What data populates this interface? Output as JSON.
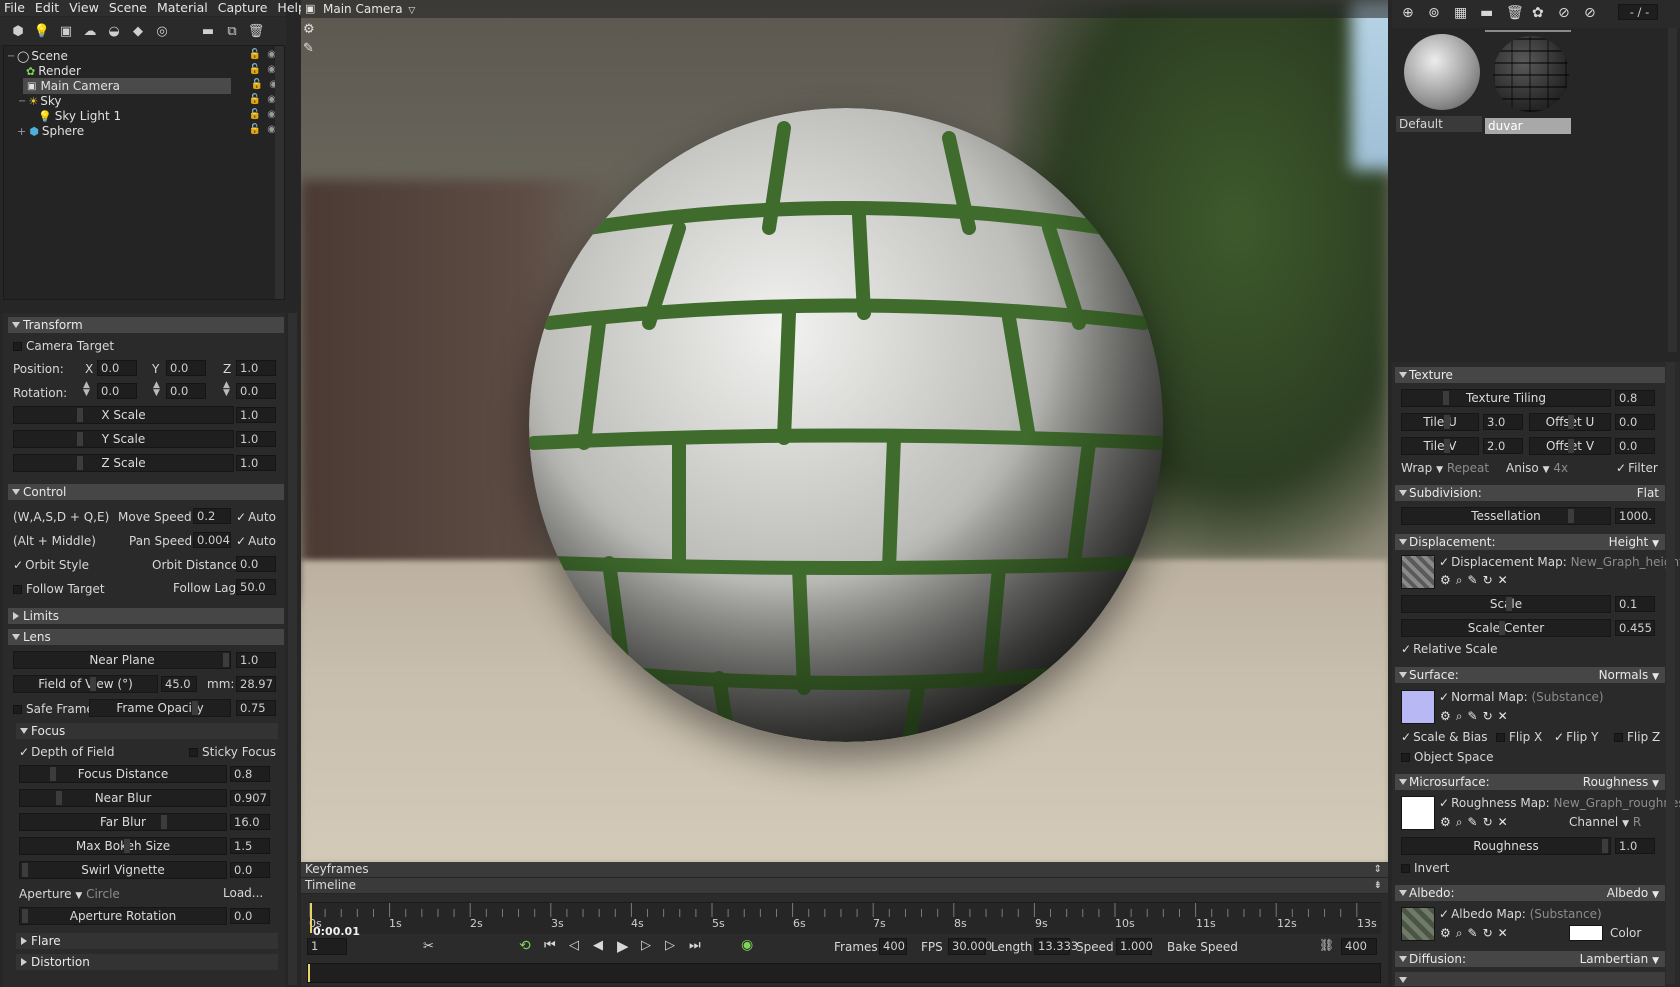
{
  "menu": [
    "File",
    "Edit",
    "View",
    "Scene",
    "Material",
    "Capture",
    "Help"
  ],
  "scene_tree": {
    "items": [
      {
        "label": "Scene",
        "indent": 0
      },
      {
        "label": "Render",
        "indent": 1
      },
      {
        "label": "Main Camera",
        "indent": 1,
        "selected": true
      },
      {
        "label": "Sky",
        "indent": 1
      },
      {
        "label": "Sky Light 1",
        "indent": 2
      },
      {
        "label": "Sphere",
        "indent": 1
      }
    ]
  },
  "transform": {
    "header": "Transform",
    "camera_target": "Camera Target",
    "position_label": "Position:",
    "rotation_label": "Rotation:",
    "x": "X",
    "y": "Y",
    "z": "Z",
    "pos_x": "0.0",
    "pos_y": "0.0",
    "pos_z": "1.0",
    "rot_x": "0.0",
    "rot_y": "0.0",
    "rot_z": "0.0",
    "x_scale": "X Scale",
    "x_scale_val": "1.0",
    "y_scale": "Y Scale",
    "y_scale_val": "1.0",
    "z_scale": "Z Scale",
    "z_scale_val": "1.0"
  },
  "control": {
    "header": "Control",
    "keys": "(W,A,S,D + Q,E)",
    "move_speed": "Move Speed:",
    "move_speed_val": "0.2",
    "auto": "Auto",
    "alt": "(Alt + Middle)",
    "pan_speed": "Pan Speed:",
    "pan_speed_val": "0.004",
    "orbit_style": "Orbit Style",
    "orbit_distance": "Orbit Distance:",
    "orbit_distance_val": "0.0",
    "follow_target": "Follow Target",
    "follow_lag": "Follow Lag",
    "follow_lag_val": "50.0"
  },
  "limits": {
    "header": "Limits"
  },
  "lens": {
    "header": "Lens",
    "near_plane": "Near Plane",
    "near_plane_val": "1.0",
    "fov": "Field of View (°)",
    "fov_val": "45.0",
    "mm": "mm:",
    "mm_val": "28.97",
    "safe_frame": "Safe Frame",
    "frame_opacity": "Frame Opacity",
    "frame_opacity_val": "0.75"
  },
  "focus": {
    "header": "Focus",
    "dof": "Depth of Field",
    "sticky": "Sticky Focus",
    "focus_distance": "Focus Distance",
    "focus_distance_val": "0.8",
    "near_blur": "Near Blur",
    "near_blur_val": "0.907",
    "far_blur": "Far Blur",
    "far_blur_val": "16.0",
    "max_bokeh": "Max Bokeh Size",
    "max_bokeh_val": "1.5",
    "swirl": "Swirl Vignette",
    "swirl_val": "0.0",
    "aperture": "Aperture",
    "aperture_val": "Circle",
    "load": "Load...",
    "aperture_rotation": "Aperture Rotation",
    "aperture_rotation_val": "0.0"
  },
  "flare": {
    "header": "Flare"
  },
  "distortion": {
    "header": "Distortion"
  },
  "viewport": {
    "camera_label": "Main Camera"
  },
  "keyframes": {
    "label": "Keyframes"
  },
  "timeline": {
    "label": "Timeline",
    "ticks": [
      "0s",
      "1s",
      "2s",
      "3s",
      "4s",
      "5s",
      "6s",
      "7s",
      "8s",
      "9s",
      "10s",
      "11s",
      "12s",
      "13s"
    ],
    "current_time": "0:00.01",
    "frame_field": "1",
    "frames_label": "Frames",
    "frames_val": "400",
    "fps_label": "FPS",
    "fps_val": "30.000",
    "length_label": "Length",
    "length_val": "13.333",
    "speed_label": "Speed",
    "speed_val": "1.000",
    "bake_speed": "Bake Speed",
    "end_frame": "400"
  },
  "materials": {
    "top_value": "- / -",
    "items": [
      {
        "label": "Default"
      },
      {
        "label": "duvar",
        "selected": true
      }
    ]
  },
  "texture": {
    "header": "Texture",
    "tiling": "Texture Tiling",
    "tiling_val": "0.8",
    "tile_u": "Tile U",
    "tile_u_val": "3.0",
    "offset_u": "Offset U",
    "offset_u_val": "0.0",
    "tile_v": "Tile V",
    "tile_v_val": "2.0",
    "offset_v": "Offset V",
    "offset_v_val": "0.0",
    "wrap": "Wrap",
    "wrap_val": "Repeat",
    "aniso": "Aniso",
    "aniso_val": "4x",
    "filter": "Filter"
  },
  "subdivision": {
    "header": "Subdivision:",
    "mode": "Flat",
    "tessellation": "Tessellation",
    "tessellation_val": "1000."
  },
  "displacement": {
    "header": "Displacement:",
    "mode": "Height",
    "map_label": "Displacement Map:",
    "map_val": "New_Graph_height.p",
    "scale": "Scale",
    "scale_val": "0.1",
    "scale_center": "Scale Center",
    "scale_center_val": "0.455",
    "relative_scale": "Relative Scale"
  },
  "surface": {
    "header": "Surface:",
    "mode": "Normals",
    "map_label": "Normal Map:",
    "map_val": "(Substance)",
    "scale_bias": "Scale & Bias",
    "flip_x": "Flip X",
    "flip_y": "Flip Y",
    "flip_z": "Flip Z",
    "object_space": "Object Space"
  },
  "microsurface": {
    "header": "Microsurface:",
    "mode": "Roughness",
    "map_label": "Roughness Map:",
    "map_val": "New_Graph_roughness",
    "channel": "Channel",
    "channel_val": "R",
    "roughness": "Roughness",
    "roughness_val": "1.0",
    "invert": "Invert"
  },
  "albedo": {
    "header": "Albedo:",
    "mode": "Albedo",
    "map_label": "Albedo Map:",
    "map_val": "(Substance)",
    "color": "Color"
  },
  "diffusion": {
    "header": "Diffusion:",
    "mode": "Lambertian"
  },
  "colors": {
    "accent": "#4a4a4a",
    "normal_swatch": "#b8b8f4",
    "mortar": "#3f6b2c"
  }
}
